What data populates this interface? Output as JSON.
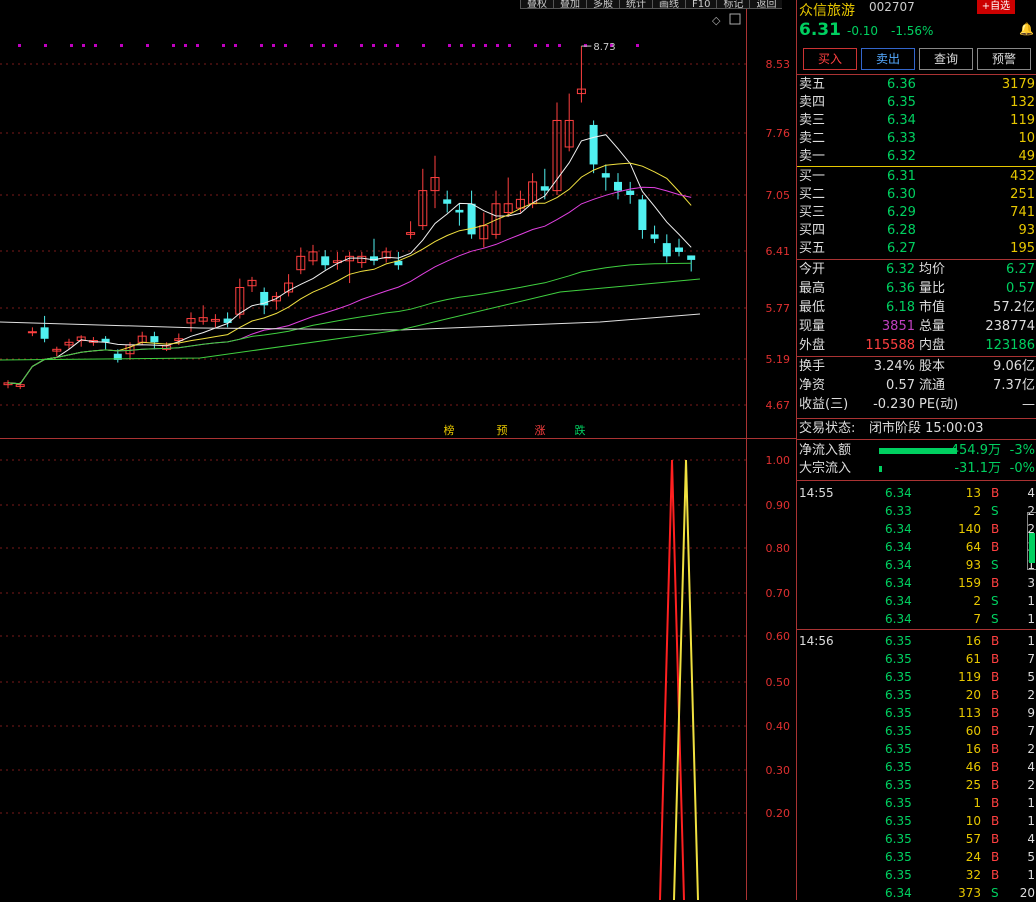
{
  "toolbar": [
    "叠权",
    "叠加",
    "多股",
    "统计",
    "画线",
    "F10",
    "标记",
    "返回"
  ],
  "chart_top": {
    "y_labels": [
      "8.53",
      "7.76",
      "7.05",
      "6.41",
      "5.77",
      "5.19",
      "4.67"
    ],
    "high_marker": "8.73",
    "signals": [
      "榜",
      "预",
      "涨",
      "跌"
    ]
  },
  "chart_bottom": {
    "y_labels": [
      "1.00",
      "0.90",
      "0.80",
      "0.70",
      "0.60",
      "0.50",
      "0.40",
      "0.30",
      "0.20"
    ]
  },
  "stock": {
    "name": "众信旅游",
    "code": "002707",
    "add_label": "+自选",
    "price": "6.31",
    "change": "-0.10",
    "pct": "-1.56%"
  },
  "actions": [
    "买入",
    "卖出",
    "查询",
    "预警"
  ],
  "asks": [
    {
      "label": "卖五",
      "price": "6.36",
      "vol": "3179"
    },
    {
      "label": "卖四",
      "price": "6.35",
      "vol": "132"
    },
    {
      "label": "卖三",
      "price": "6.34",
      "vol": "119"
    },
    {
      "label": "卖二",
      "price": "6.33",
      "vol": "10"
    },
    {
      "label": "卖一",
      "price": "6.32",
      "vol": "49"
    }
  ],
  "bids": [
    {
      "label": "买一",
      "price": "6.31",
      "vol": "432"
    },
    {
      "label": "买二",
      "price": "6.30",
      "vol": "251"
    },
    {
      "label": "买三",
      "price": "6.29",
      "vol": "741"
    },
    {
      "label": "买四",
      "price": "6.28",
      "vol": "93"
    },
    {
      "label": "买五",
      "price": "6.27",
      "vol": "195"
    }
  ],
  "stats": [
    {
      "l1": "今开",
      "v1": "6.32",
      "l2": "均价",
      "v2": "6.27"
    },
    {
      "l1": "最高",
      "v1": "6.36",
      "l2": "量比",
      "v2": "0.57"
    },
    {
      "l1": "最低",
      "v1": "6.18",
      "l2": "市值",
      "v2": "57.2亿"
    },
    {
      "l1": "现量",
      "v1": "3851",
      "l2": "总量",
      "v2": "238774"
    },
    {
      "l1": "外盘",
      "v1": "115588",
      "l2": "内盘",
      "v2": "123186"
    }
  ],
  "stats2": [
    {
      "l1": "换手",
      "v1": "3.24%",
      "l2": "股本",
      "v2": "9.06亿"
    },
    {
      "l1": "净资",
      "v1": "0.57",
      "l2": "流通",
      "v2": "7.37亿"
    },
    {
      "l1": "收益(三)",
      "v1": "-0.230",
      "l2": "PE(动)",
      "v2": "—"
    }
  ],
  "trade_status": {
    "label": "交易状态:",
    "value": "闭市阶段 15:00:03"
  },
  "flows": [
    {
      "label": "净流入额",
      "value": "-454.9万",
      "pct": "-3%"
    },
    {
      "label": "大宗流入",
      "value": "-31.1万",
      "pct": "-0%"
    }
  ],
  "ticks_1": {
    "time": "14:55",
    "rows": [
      {
        "p": "6.34",
        "v": "13",
        "s": "B",
        "n": "4"
      },
      {
        "p": "6.33",
        "v": "2",
        "s": "S",
        "n": "2"
      },
      {
        "p": "6.34",
        "v": "140",
        "s": "B",
        "n": "2"
      },
      {
        "p": "6.34",
        "v": "64",
        "s": "B",
        "n": "3"
      },
      {
        "p": "6.34",
        "v": "93",
        "s": "S",
        "n": "1"
      },
      {
        "p": "6.34",
        "v": "159",
        "s": "B",
        "n": "3"
      },
      {
        "p": "6.34",
        "v": "2",
        "s": "S",
        "n": "1"
      },
      {
        "p": "6.34",
        "v": "7",
        "s": "S",
        "n": "1"
      }
    ]
  },
  "ticks_2": {
    "time": "14:56",
    "rows": [
      {
        "p": "6.35",
        "v": "16",
        "s": "B",
        "n": "1"
      },
      {
        "p": "6.35",
        "v": "61",
        "s": "B",
        "n": "7"
      },
      {
        "p": "6.35",
        "v": "119",
        "s": "B",
        "n": "5"
      },
      {
        "p": "6.35",
        "v": "20",
        "s": "B",
        "n": "2"
      },
      {
        "p": "6.35",
        "v": "113",
        "s": "B",
        "n": "9"
      },
      {
        "p": "6.35",
        "v": "60",
        "s": "B",
        "n": "7"
      },
      {
        "p": "6.35",
        "v": "16",
        "s": "B",
        "n": "2"
      },
      {
        "p": "6.35",
        "v": "46",
        "s": "B",
        "n": "4"
      },
      {
        "p": "6.35",
        "v": "25",
        "s": "B",
        "n": "2"
      },
      {
        "p": "6.35",
        "v": "1",
        "s": "B",
        "n": "1"
      },
      {
        "p": "6.35",
        "v": "10",
        "s": "B",
        "n": "1"
      },
      {
        "p": "6.35",
        "v": "57",
        "s": "B",
        "n": "4"
      },
      {
        "p": "6.35",
        "v": "24",
        "s": "B",
        "n": "5"
      },
      {
        "p": "6.35",
        "v": "32",
        "s": "B",
        "n": "1"
      },
      {
        "p": "6.34",
        "v": "373",
        "s": "S",
        "n": "20"
      }
    ]
  },
  "colors": {
    "up": "#ff4040",
    "down": "#00d060",
    "accent": "#e8c800"
  }
}
